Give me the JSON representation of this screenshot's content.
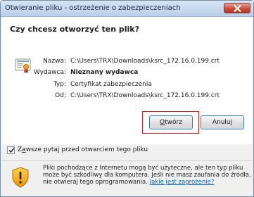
{
  "window": {
    "title": "Otwieranie pliku - ostrzeżenie o zabezpieczeniach"
  },
  "dialog": {
    "question": "Czy chcesz otworzyć ten plik?",
    "details": [
      {
        "label": "Nazwa:",
        "value": "C:\\Users\\TRX\\Downloads\\ksrc_172.16.0.199.crt"
      },
      {
        "label": "Wydawca:",
        "value": "Nieznany wydawca"
      },
      {
        "label": "Typ:",
        "value": "Certyfikat zabezpieczenia"
      },
      {
        "label": "Od:",
        "value": "C:\\Users\\TRX\\Downloads\\ksrc_172.16.0.199.crt"
      }
    ],
    "buttons": {
      "open_label_accel": "O",
      "open_label_rest": "twórz",
      "cancel_label": "Anuluj"
    },
    "checkbox": {
      "label_pre": "Z",
      "label_accel": "a",
      "label_post": "wsze pytaj przed otwarciem tego pliku",
      "checked": true
    },
    "warning": {
      "text": "Pliki pochodzące z Internetu mogą być użyteczne, ale ten typ pliku może być szkodliwy dla komputera. Jeśli nie masz zaufania do źródła, nie otwieraj tego oprogramowania.",
      "link": "Jakie jest zagrożenie?"
    }
  },
  "icons": {
    "close": "close-icon",
    "certificate": "certificate-icon",
    "warning": "warning-shield-icon",
    "checkmark": "checkmark-icon"
  },
  "colors": {
    "link": "#0066cc",
    "highlight_border": "#d22020",
    "close_button": "#c7503b"
  }
}
